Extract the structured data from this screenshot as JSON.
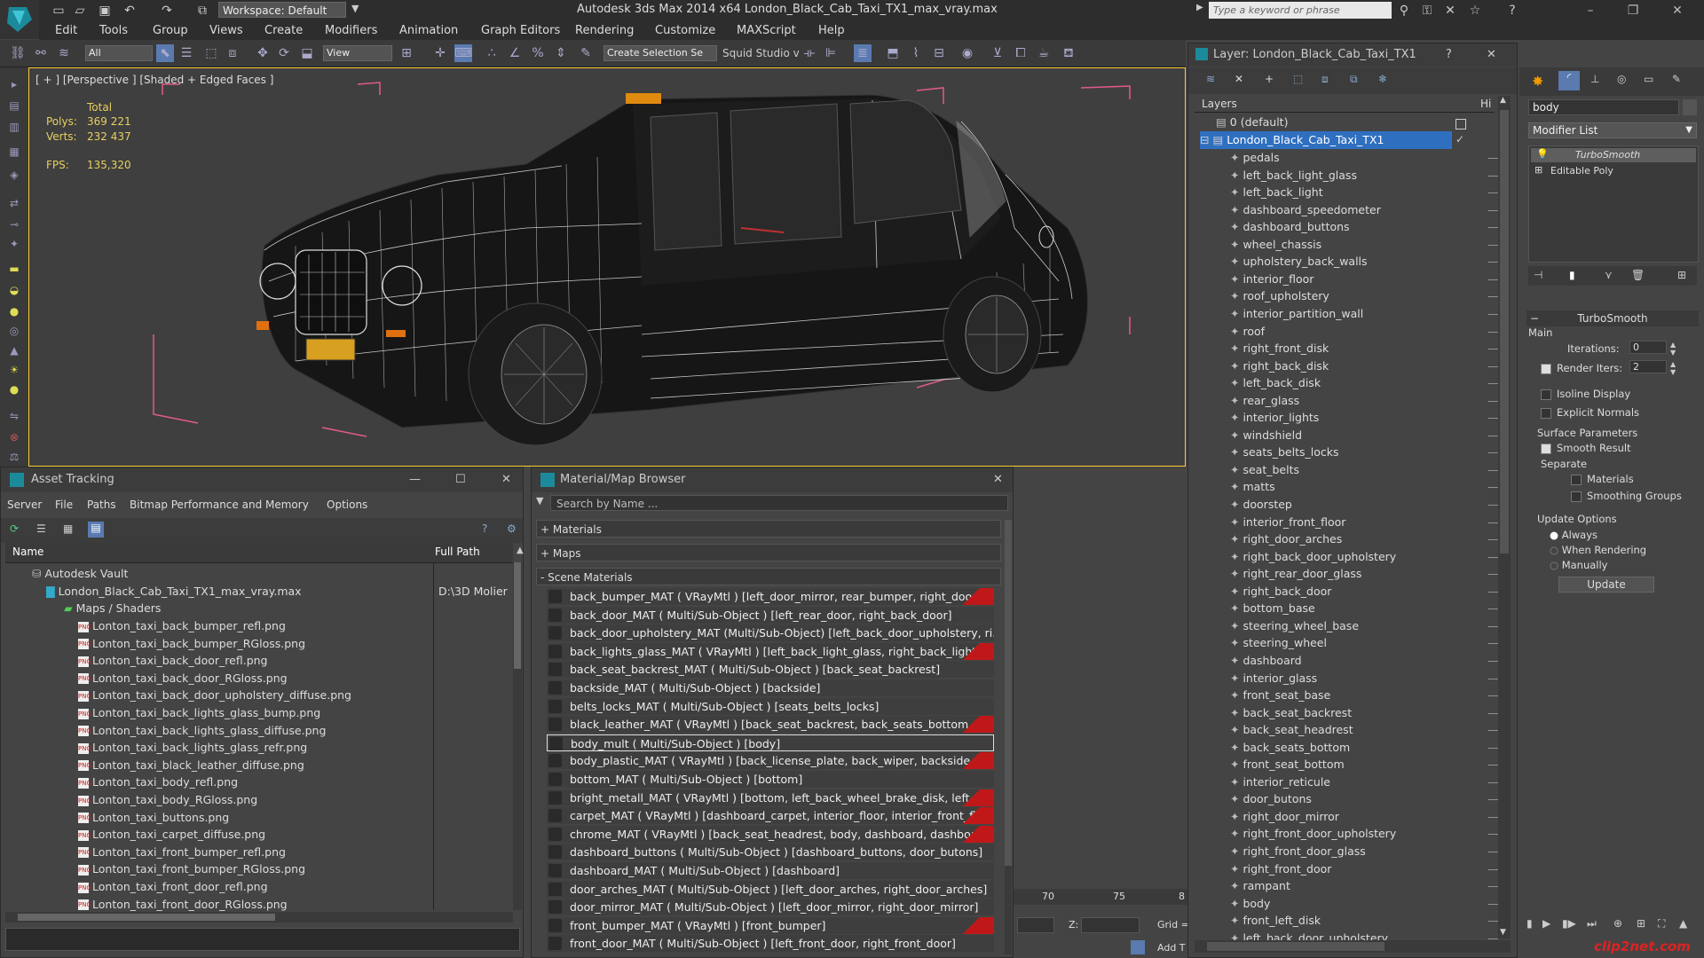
{
  "title_bar": {
    "workspace": "Workspace: Default",
    "window_title": "Autodesk 3ds Max  2014 x64      London_Black_Cab_Taxi_TX1_max_vray.max",
    "search_placeholder": "Type a keyword or phrase"
  },
  "menu": [
    "Edit",
    "Tools",
    "Group",
    "Views",
    "Create",
    "Modifiers",
    "Animation",
    "Graph Editors",
    "Rendering",
    "Customize",
    "MAXScript",
    "Help"
  ],
  "toolbar": {
    "filter_dropdown": "All",
    "ref_coord_dropdown": "View",
    "selection_set": "Create Selection Se",
    "squid_label": "Squid Studio v"
  },
  "viewport": {
    "label": "[ + ] [Perspective ] [Shaded + Edged Faces ]",
    "stats_header": "Total",
    "polys_label": "Polys:",
    "polys_value": "369 221",
    "verts_label": "Verts:",
    "verts_value": "232 437",
    "fps_label": "FPS:",
    "fps_value": "135,320"
  },
  "asset_tracking": {
    "title": "Asset Tracking",
    "menu": [
      "Server",
      "File",
      "Paths",
      "Bitmap Performance and Memory",
      "Options"
    ],
    "col_name": "Name",
    "col_path": "Full Path",
    "vault": "Autodesk Vault",
    "file": "London_Black_Cab_Taxi_TX1_max_vray.max",
    "file_path": "D:\\3D Molier",
    "maps_folder": "Maps / Shaders",
    "maps": [
      "Lonton_taxi_back_bumper_refl.png",
      "Lonton_taxi_back_bumper_RGloss.png",
      "Lonton_taxi_back_door_refl.png",
      "Lonton_taxi_back_door_RGloss.png",
      "Lonton_taxi_back_door_upholstery_diffuse.png",
      "Lonton_taxi_back_lights_glass_bump.png",
      "Lonton_taxi_back_lights_glass_diffuse.png",
      "Lonton_taxi_back_lights_glass_refr.png",
      "Lonton_taxi_black_leather_diffuse.png",
      "Lonton_taxi_body_refl.png",
      "Lonton_taxi_body_RGloss.png",
      "Lonton_taxi_buttons.png",
      "Lonton_taxi_carpet_diffuse.png",
      "Lonton_taxi_front_bumper_refl.png",
      "Lonton_taxi_front_bumper_RGloss.png",
      "Lonton_taxi_front_door_refl.png",
      "Lonton_taxi_front_door_RGloss.png"
    ]
  },
  "material_browser": {
    "title": "Material/Map Browser",
    "search_placeholder": "Search by Name ...",
    "sections": [
      "+ Materials",
      "+ Maps",
      "- Scene Materials"
    ],
    "materials": [
      {
        "text": "back_bumper_MAT  ( VRayMtl )  [left_door_mirror, rear_bumper, right_door_mir...",
        "red": true
      },
      {
        "text": "back_door_MAT  ( Multi/Sub-Object )  [left_rear_door, right_back_door]",
        "red": false
      },
      {
        "text": "back_door_upholstery_MAT  (Multi/Sub-Object)  [left_back_door_upholstery, ri...",
        "red": false
      },
      {
        "text": "back_lights_glass_MAT  ( VRayMtl )  [left_back_light_glass, right_back_light_glass]",
        "red": true
      },
      {
        "text": "back_seat_backrest_MAT  ( Multi/Sub-Object )  [back_seat_backrest]",
        "red": false
      },
      {
        "text": "backside_MAT  ( Multi/Sub-Object )  [backside]",
        "red": false
      },
      {
        "text": "belts_locks_MAT  ( Multi/Sub-Object )  [seats_belts_locks]",
        "red": false
      },
      {
        "text": "black_leather_MAT  ( VRayMtl )  [back_seat_backrest, back_seats_bottom, front...",
        "red": true
      },
      {
        "text": "body_mult  ( Multi/Sub-Object )  [body]",
        "red": false
      },
      {
        "text": "body_plastic_MAT  ( VRayMtl )  [back_license_plate, back_wiper, backside, body,...",
        "red": true
      },
      {
        "text": "bottom_MAT  ( Multi/Sub-Object )  [bottom]",
        "red": false
      },
      {
        "text": "bright_metall_MAT  ( VRayMtl )  [bottom, left_back_wheel_brake_disk, left_front...",
        "red": true
      },
      {
        "text": "carpet_MAT  ( VRayMtl )  [dashboard_carpet, interior_floor, interior_front_floor,...",
        "red": true
      },
      {
        "text": "chrome_MAT  ( VRayMtl )  [back_seat_headrest, body, dashboard, dashboard_b...",
        "red": true
      },
      {
        "text": "dashboard_buttons  ( Multi/Sub-Object )  [dashboard_buttons, door_butons]",
        "red": false
      },
      {
        "text": "dashboard_MAT  ( Multi/Sub-Object )  [dashboard]",
        "red": false
      },
      {
        "text": "door_arches_MAT  ( Multi/Sub-Object )  [left_door_arches, right_door_arches]",
        "red": false
      },
      {
        "text": "door_mirror_MAT  ( Multi/Sub-Object )  [left_door_mirror, right_door_mirror]",
        "red": false
      },
      {
        "text": "front_bumper_MAT  ( VRayMtl )  [front_bumper]",
        "red": true
      },
      {
        "text": "front_door_MAT  ( Multi/Sub-Object )  [left_front_door, right_front_door]",
        "red": false
      }
    ]
  },
  "layer_panel": {
    "title": "Layer: London_Black_Cab_Taxi_TX1",
    "header": "Layers",
    "header_right": "Hi",
    "default_layer": "0 (default)",
    "active_layer": "London_Black_Cab_Taxi_TX1",
    "items": [
      "pedals",
      "left_back_light_glass",
      "left_back_light",
      "dashboard_speedometer",
      "dashboard_buttons",
      "wheel_chassis",
      "upholstery_back_walls",
      "interior_floor",
      "roof_upholstery",
      "interior_partition_wall",
      "roof",
      "right_front_disk",
      "right_back_disk",
      "left_back_disk",
      "rear_glass",
      "interior_lights",
      "windshield",
      "seats_belts_locks",
      "seat_belts",
      "matts",
      "doorstep",
      "interior_front_floor",
      "right_door_arches",
      "right_back_door_upholstery",
      "right_rear_door_glass",
      "right_back_door",
      "bottom_base",
      "steering_wheel_base",
      "steering_wheel",
      "dashboard",
      "interior_glass",
      "front_seat_base",
      "back_seat_backrest",
      "back_seat_headrest",
      "back_seats_bottom",
      "front_seat_bottom",
      "interior_reticule",
      "door_butons",
      "right_door_mirror",
      "right_front_door_upholstery",
      "right_front_door_glass",
      "right_front_door",
      "rampant",
      "body",
      "front_left_disk",
      "left_back_door_upholstery"
    ]
  },
  "command_panel": {
    "object_name": "body",
    "modifier_list": "Modifier List",
    "stack": [
      "TurboSmooth",
      "Editable Poly"
    ],
    "rollout": "TurboSmooth",
    "main": "Main",
    "iterations_label": "Iterations:",
    "iterations_value": "0",
    "render_iters_label": "Render Iters:",
    "render_iters_value": "2",
    "isoline": "Isoline Display",
    "explicit": "Explicit Normals",
    "surface": "Surface Parameters",
    "smooth": "Smooth Result",
    "separate": "Separate",
    "materials": "Materials",
    "smoothing": "Smoothing Groups",
    "update_options": "Update Options",
    "always": "Always",
    "when_rendering": "When Rendering",
    "manually": "Manually",
    "update_button": "Update"
  },
  "timeline": {
    "ticks": [
      "70",
      "75",
      "8"
    ],
    "z_label": "Z:",
    "grid_label": "Grid =",
    "add_label": "Add T"
  },
  "watermark": "clip2net.com"
}
